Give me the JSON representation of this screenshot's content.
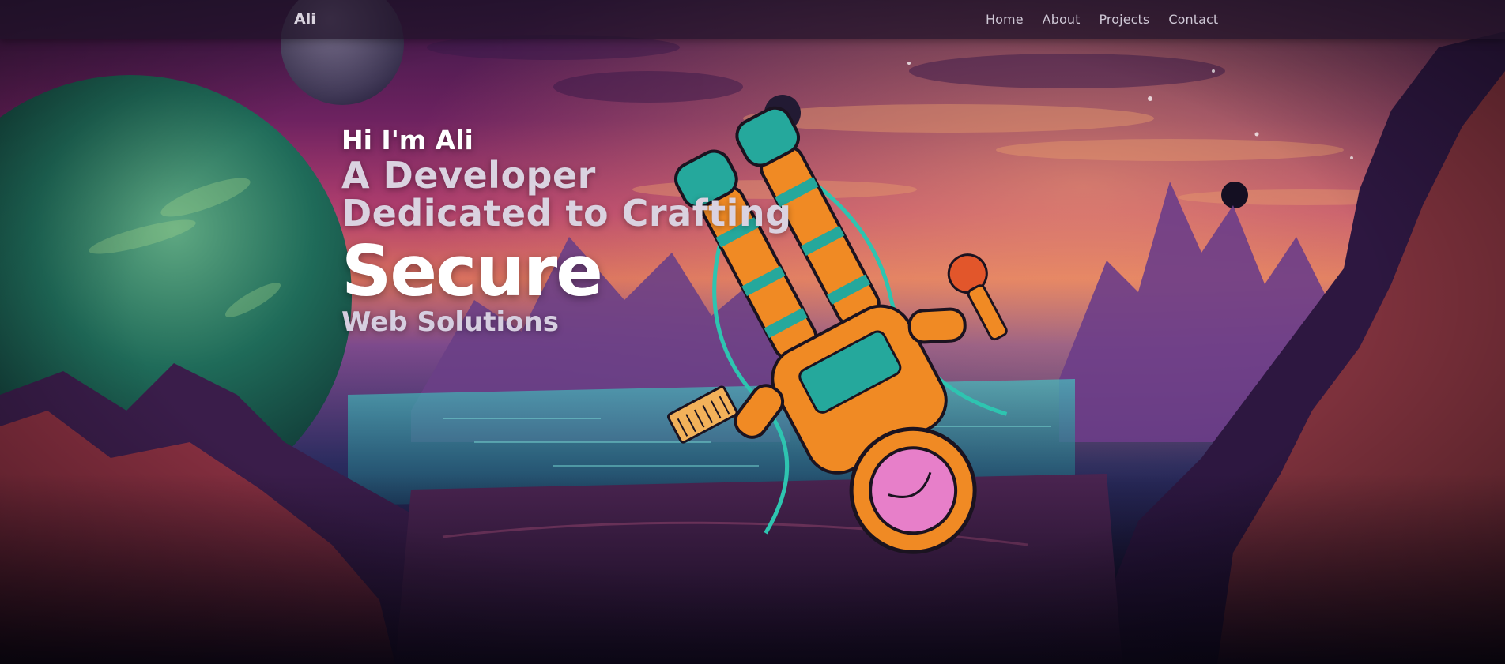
{
  "nav": {
    "brand": "Ali",
    "links": [
      "Home",
      "About",
      "Projects",
      "Contact"
    ]
  },
  "hero": {
    "greeting": "Hi I'm Ali",
    "line1": "A Developer",
    "line2": "Dedicated to Crafting",
    "highlight": "Secure",
    "subline": "Web Solutions"
  },
  "illustration": {
    "subject": "astronaut-floating-over-alien-landscape",
    "palette": {
      "sky_top": "#3b1a4a",
      "sky_mid": "#a8386e",
      "sky_glow": "#e8905a",
      "mountains": "#5a3b7a",
      "water": "#2aa7a8",
      "planet": "#1f6b59",
      "suit_orange": "#f08a24",
      "suit_teal": "#25a89c",
      "rock_red": "#b33b3b"
    }
  }
}
